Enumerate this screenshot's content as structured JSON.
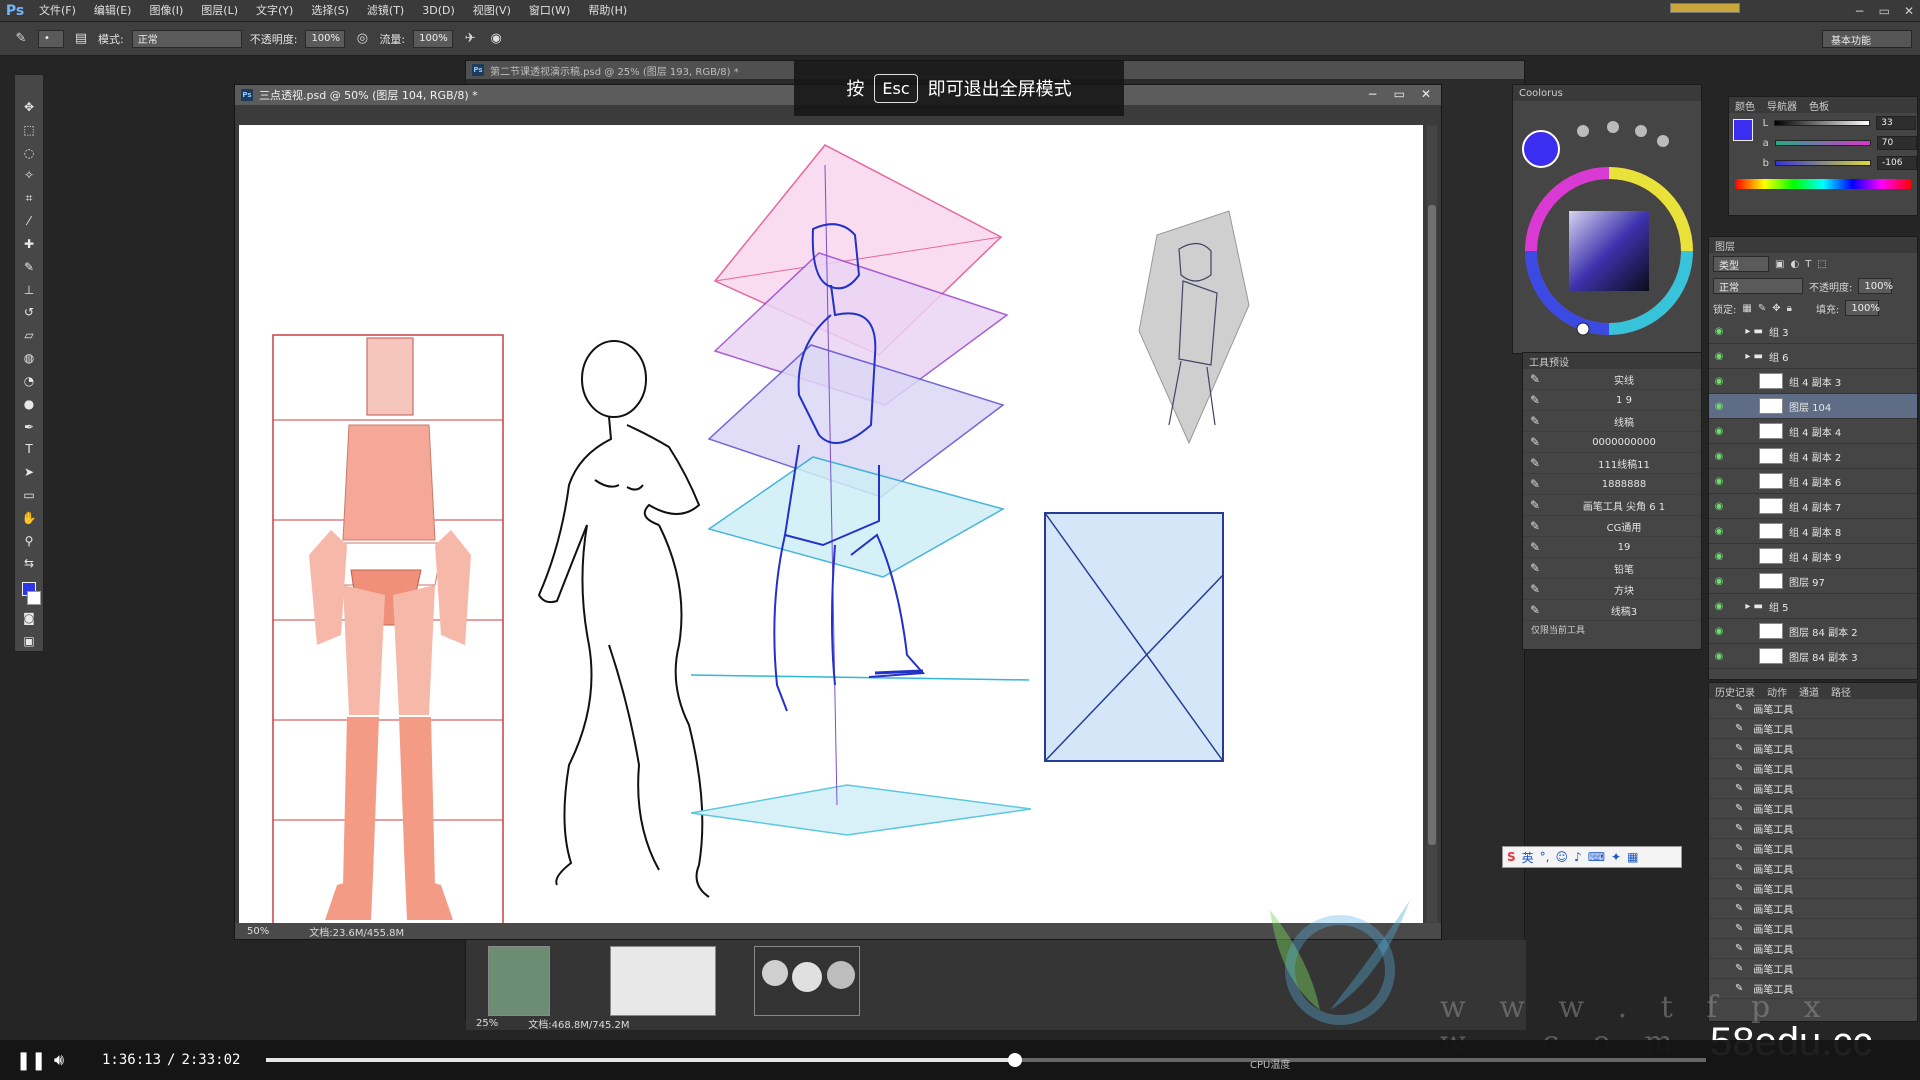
{
  "menubar": {
    "logo": "Ps",
    "items": [
      "文件(F)",
      "编辑(E)",
      "图像(I)",
      "图层(L)",
      "文字(Y)",
      "选择(S)",
      "滤镜(T)",
      "3D(D)",
      "视图(V)",
      "窗口(W)",
      "帮助(H)"
    ],
    "controls": [
      "−",
      "▭",
      "✕"
    ]
  },
  "optbar": {
    "mode_label": "模式:",
    "mode_value": "正常",
    "opacity_label": "不透明度:",
    "opacity_value": "100%",
    "flow_label": "流量:",
    "flow_value": "100%",
    "workspace": "基本功能"
  },
  "back_doc": {
    "title": "第二节课透视演示稿.psd @ 25% (图层 193, RGB/8) *"
  },
  "doc": {
    "title": "三点透视.psd @ 50% (图层 104, RGB/8) *",
    "zoom": "50%",
    "docsize": "文档:23.6M/455.8M"
  },
  "esc_overlay": {
    "press": "按",
    "key": "Esc",
    "text": "即可退出全屏模式"
  },
  "coolorus": {
    "title": "Coolorus",
    "accent": "#3b2ef0"
  },
  "color_panel": {
    "tabs": [
      "颜色",
      "导航器",
      "色板"
    ],
    "sliders": [
      {
        "label": "L",
        "value": "33"
      },
      {
        "label": "a",
        "value": "70"
      },
      {
        "label": "b",
        "value": "-106"
      }
    ]
  },
  "presets": {
    "title": "工具预设",
    "items": [
      "实线",
      "1    9",
      "线稿",
      "0000000000",
      "111线稿11",
      "1888888",
      "画笔工具 尖角 6 1",
      "CG通用",
      "19",
      "铅笔",
      "方块",
      "线稿3"
    ],
    "footer": "仅限当前工具"
  },
  "layers": {
    "title": "图层",
    "kind_label": "类型",
    "blend_mode": "正常",
    "opacity_label": "不透明度:",
    "opacity_value": "100%",
    "lock_label": "锁定:",
    "fill_label": "填充:",
    "fill_value": "100%",
    "rows": [
      {
        "name": "组 3",
        "kind": "group",
        "selected": false
      },
      {
        "name": "组 6",
        "kind": "group",
        "selected": false
      },
      {
        "name": "组 4 副本 3",
        "kind": "layer",
        "selected": false
      },
      {
        "name": "图层 104",
        "kind": "layer",
        "selected": true
      },
      {
        "name": "组 4 副本 4",
        "kind": "layer",
        "selected": false
      },
      {
        "name": "组 4 副本 2",
        "kind": "layer",
        "selected": false
      },
      {
        "name": "组 4 副本 6",
        "kind": "layer",
        "selected": false
      },
      {
        "name": "组 4 副本 7",
        "kind": "layer",
        "selected": false
      },
      {
        "name": "组 4 副本 8",
        "kind": "layer",
        "selected": false
      },
      {
        "name": "组 4 副本 9",
        "kind": "layer",
        "selected": false
      },
      {
        "name": "图层 97",
        "kind": "layer",
        "selected": false
      },
      {
        "name": "组 5",
        "kind": "group",
        "selected": false
      },
      {
        "name": "图层 84 副本 2",
        "kind": "layer",
        "selected": false
      },
      {
        "name": "图层 84 副本 3",
        "kind": "layer",
        "selected": false
      }
    ]
  },
  "history": {
    "tabs": [
      "历史记录",
      "动作",
      "通道",
      "路径"
    ],
    "items": [
      "画笔工具",
      "画笔工具",
      "画笔工具",
      "画笔工具",
      "画笔工具",
      "画笔工具",
      "画笔工具",
      "画笔工具",
      "画笔工具",
      "画笔工具",
      "画笔工具",
      "画笔工具",
      "画笔工具",
      "画笔工具",
      "画笔工具"
    ]
  },
  "ime": {
    "label": "英"
  },
  "thumbstrip": {
    "zoom": "25%",
    "docsize": "文档:468.8M/745.2M"
  },
  "watermark": {
    "url": "w w w . t f p x w . c o m",
    "site": "58edu.cc"
  },
  "player": {
    "current": "1:36:13",
    "separator": "/",
    "total": "2:33:02",
    "progress": 0.52,
    "cpu": "CPU温度"
  }
}
